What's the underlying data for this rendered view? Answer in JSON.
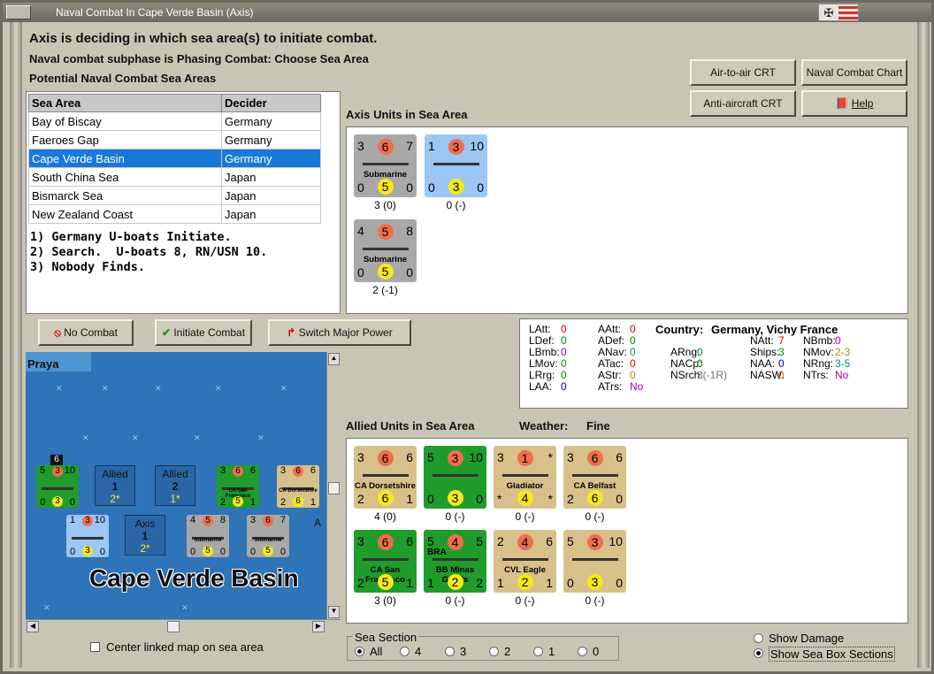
{
  "window": {
    "title": "Naval Combat In Cape Verde Basin (Axis)"
  },
  "header": {
    "line1": "Axis is deciding in which sea area(s) to initiate combat.",
    "line2": "Naval combat subphase is Phasing Combat: Choose Sea Area",
    "line3": "Potential Naval Combat Sea Areas"
  },
  "buttons": {
    "air_to_air": "Air-to-air CRT",
    "naval_chart": "Naval Combat Chart",
    "anti_aircraft": "Anti-aircraft CRT",
    "help": "Help",
    "no_combat": "No Combat",
    "initiate": "Initiate Combat",
    "switch": "Switch Major Power"
  },
  "sea_table": {
    "headers": [
      "Sea Area",
      "Decider"
    ],
    "rows": [
      [
        "Bay of Biscay",
        "Germany"
      ],
      [
        "Faeroes Gap",
        "Germany"
      ],
      [
        "Cape Verde Basin",
        "Germany"
      ],
      [
        "South China Sea",
        "Japan"
      ],
      [
        "Bismarck Sea",
        "Japan"
      ],
      [
        "New Zealand Coast",
        "Japan"
      ]
    ],
    "selected": 2
  },
  "log": [
    "1) Germany U-boats Initiate.",
    "2) Search.  U-boats 8, RN/USN 10.",
    "3) Nobody Finds."
  ],
  "axis_units": {
    "title": "Axis Units in Sea Area",
    "units": [
      {
        "tl": "3",
        "tc": "6",
        "tr": "7",
        "name": "Submarine",
        "bl": "0",
        "bc": "5",
        "br": "0",
        "caption": "3 (0)"
      },
      {
        "tl": "1",
        "tc": "3",
        "tr": "10",
        "name": "",
        "bl": "0",
        "bc": "3",
        "br": "0",
        "caption": "0 (-)"
      },
      {
        "tl": "4",
        "tc": "5",
        "tr": "8",
        "name": "Submarine",
        "bl": "0",
        "bc": "5",
        "br": "0",
        "caption": "2 (-1)"
      }
    ]
  },
  "stats": {
    "country_label": "Country:",
    "country": "Germany, Vichy France",
    "items": [
      [
        "LAtt:",
        "0",
        "#d00"
      ],
      [
        "LDef:",
        "0",
        "#080"
      ],
      [
        "LBmb:",
        "0",
        "#a0a"
      ],
      [
        "LMov:",
        "0",
        "#080"
      ],
      [
        "LRrg:",
        "0",
        "#080"
      ],
      [
        "LAA:",
        "0",
        "#00a"
      ],
      [
        "AAtt:",
        "0",
        "#d00"
      ],
      [
        "ADef:",
        "0",
        "#080"
      ],
      [
        "ANav:",
        "0",
        "#088"
      ],
      [
        "ATac:",
        "0",
        "#d00"
      ],
      [
        "AStr:",
        "0",
        "#d70"
      ],
      [
        "ATrs:",
        "No",
        "#a0a"
      ],
      [
        "ARng:",
        "0",
        "#088"
      ],
      [
        "NACp:",
        "0",
        "#080"
      ],
      [
        "NSrch:",
        "3(-1R)",
        "#777"
      ],
      [
        "NAtt:",
        "7",
        "#d00"
      ],
      [
        "Ships:",
        "3",
        "#080"
      ],
      [
        "NAA:",
        "0",
        "#00a"
      ],
      [
        "NASW:",
        "0",
        "#d70"
      ],
      [
        "NBmb:",
        "0",
        "#a0a"
      ],
      [
        "NMov:",
        "2-3",
        "#b80"
      ],
      [
        "NRng:",
        "3-5",
        "#088"
      ],
      [
        "NTrs:",
        "No",
        "#a0a"
      ]
    ]
  },
  "allied_units": {
    "title": "Allied Units in Sea Area",
    "weather_label": "Weather:",
    "weather": "Fine",
    "units": [
      {
        "tl": "3",
        "tc": "6",
        "tr": "6",
        "name": "CA Dorsetshire",
        "bl": "2",
        "bc": "6",
        "br": "1",
        "caption": "4 (0)"
      },
      {
        "tl": "5",
        "tc": "3",
        "tr": "10",
        "name": "",
        "bl": "0",
        "bc": "3",
        "br": "0",
        "caption": "0 (-)"
      },
      {
        "tl": "3",
        "tc": "1",
        "tr": "*",
        "name": "Gladiator",
        "bl": "*",
        "bc": "4",
        "br": "*",
        "caption": "0 (-)"
      },
      {
        "tl": "3",
        "tc": "6",
        "tr": "6",
        "name": "CA Belfast",
        "bl": "2",
        "bc": "6",
        "br": "0",
        "caption": "0 (-)"
      },
      {
        "tl": "3",
        "tc": "6",
        "tr": "6",
        "name": "CA San Francisco",
        "bl": "2",
        "bc": "5",
        "br": "1",
        "caption": "3 (0)"
      },
      {
        "tl": "5",
        "tc": "4",
        "tr": "5",
        "name": "BB Minas Gerais",
        "bl": "1",
        "bc": "2",
        "br": "2",
        "caption": "0 (-)",
        "flag": "BRA"
      },
      {
        "tl": "2",
        "tc": "4",
        "tr": "6",
        "name": "CVL Eagle",
        "bl": "1",
        "bc": "2",
        "br": "1",
        "caption": "0 (-)"
      },
      {
        "tl": "5",
        "tc": "3",
        "tr": "10",
        "name": "",
        "bl": "0",
        "bc": "3",
        "br": "0",
        "caption": "0 (-)"
      }
    ]
  },
  "map": {
    "port": "Praya",
    "sea_name": "Cape Verde Basin",
    "boxes": [
      {
        "side": "Allied",
        "num": "1",
        "sub": "2*"
      },
      {
        "side": "Allied",
        "num": "2",
        "sub": "1*"
      },
      {
        "side": "Axis",
        "num": "1",
        "sub": "2*"
      }
    ],
    "map_units": [
      {
        "tl": "5",
        "tc": "3",
        "tr": "10",
        "bl": "0",
        "bc": "3",
        "br": "0",
        "name": ""
      },
      {
        "tl": "3",
        "tc": "6",
        "tr": "6",
        "bl": "2",
        "bc": "5",
        "br": "1",
        "name": "CA San Francisco"
      },
      {
        "tl": "3",
        "tc": "6",
        "tr": "6",
        "bl": "2",
        "bc": "6",
        "br": "1",
        "name": "CA Dorsetshire"
      },
      {
        "tl": "1",
        "tc": "3",
        "tr": "10",
        "bl": "0",
        "bc": "3",
        "br": "0",
        "name": ""
      },
      {
        "tl": "4",
        "tc": "5",
        "tr": "8",
        "bl": "0",
        "bc": "5",
        "br": "0",
        "name": "Submarine"
      },
      {
        "tl": "3",
        "tc": "6",
        "tr": "7",
        "bl": "0",
        "bc": "5",
        "br": "0",
        "name": "Submarine"
      }
    ],
    "stack_count": "6",
    "cutoff_label": "A"
  },
  "center_map_label": "Center linked map on sea area",
  "sea_section": {
    "title": "Sea Section",
    "options": [
      "All",
      "4",
      "3",
      "2",
      "1",
      "0"
    ],
    "selected": 0
  },
  "options": {
    "show_damage": "Show Damage",
    "show_sections": "Show Sea Box Sections"
  },
  "colors": {
    "tan": "#d8c08a",
    "green": "#1f9c2c",
    "grey": "#a8a8a8",
    "lightblue": "#9cc6f4",
    "select": "#1979d8"
  }
}
